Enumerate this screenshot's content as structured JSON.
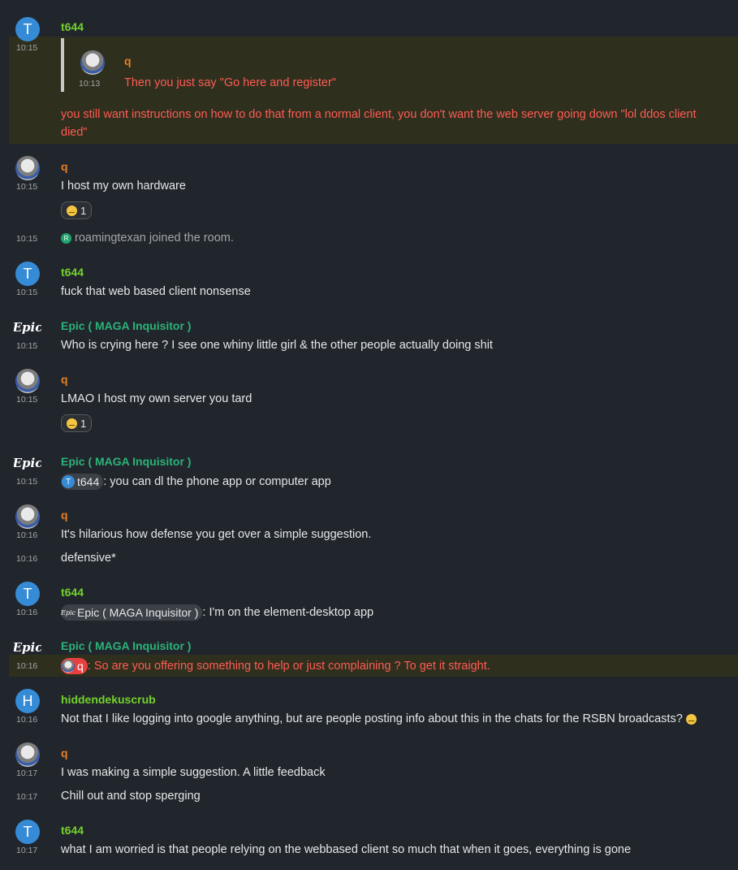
{
  "colors": {
    "background": "#21262c",
    "green_sender": "#74d12c",
    "orange_sender": "#e57e27",
    "teal_sender": "#2bb378",
    "highlight_text": "#ff5b55"
  },
  "messages": [
    {
      "sender": "t644",
      "avatar": "T",
      "time": "10:15",
      "quote": {
        "sender": "q",
        "time": "10:13",
        "text": "Then you just say \"Go here and register\""
      },
      "text": "you still want instructions on how to do that from a normal client, you don't want the web server going down \"lol ddos client",
      "text2": "died\""
    },
    {
      "sender": "q",
      "time": "10:15",
      "text": "I host my own hardware",
      "reaction": "1"
    },
    {
      "time": "10:15",
      "state_avatar": "R",
      "state_text": "roamingtexan joined the room."
    },
    {
      "sender": "t644",
      "avatar": "T",
      "time": "10:15",
      "text": "fuck that web based client nonsense"
    },
    {
      "sender": "Epic ( MAGA Inquisitor )",
      "avatar": "Epic",
      "time": "10:15",
      "text": "Who is crying here ? I see one whiny little girl & the other people actually doing shit"
    },
    {
      "sender": "q",
      "time": "10:15",
      "text": "LMAO I host my own server you tard",
      "reaction": "1"
    },
    {
      "sender": "Epic ( MAGA Inquisitor )",
      "avatar": "Epic",
      "time": "10:15",
      "pill_avatar": "T",
      "pill": "t644",
      "text": ": you can dl the phone app or computer app"
    },
    {
      "sender": "q",
      "time": "10:16",
      "text": "It's hilarious how defense you get over a simple suggestion."
    },
    {
      "time": "10:16",
      "text": "defensive*"
    },
    {
      "sender": "t644",
      "avatar": "T",
      "time": "10:16",
      "pill_avatar": "Epic",
      "pill": "Epic ( MAGA Inquisitor )",
      "text": ": I'm on the element-desktop app"
    },
    {
      "sender": "Epic ( MAGA Inquisitor )",
      "avatar": "Epic",
      "time": "10:16",
      "pill": "q",
      "text": ": So are you offering something to help or just complaining ? To get it straight."
    },
    {
      "sender": "hiddendekuscrub",
      "avatar": "H",
      "time": "10:16",
      "text": "Not that I like logging into google anything, but are people posting info about this in the chats for the RSBN broadcasts?"
    },
    {
      "sender": "q",
      "time": "10:17",
      "text": "I was making a simple suggestion. A little feedback"
    },
    {
      "time": "10:17",
      "text": "Chill out and stop sperging"
    },
    {
      "sender": "t644",
      "avatar": "T",
      "time": "10:17",
      "text": "what I am worried is that people relying on the webbased client so much that when it goes, everything is gone"
    }
  ]
}
